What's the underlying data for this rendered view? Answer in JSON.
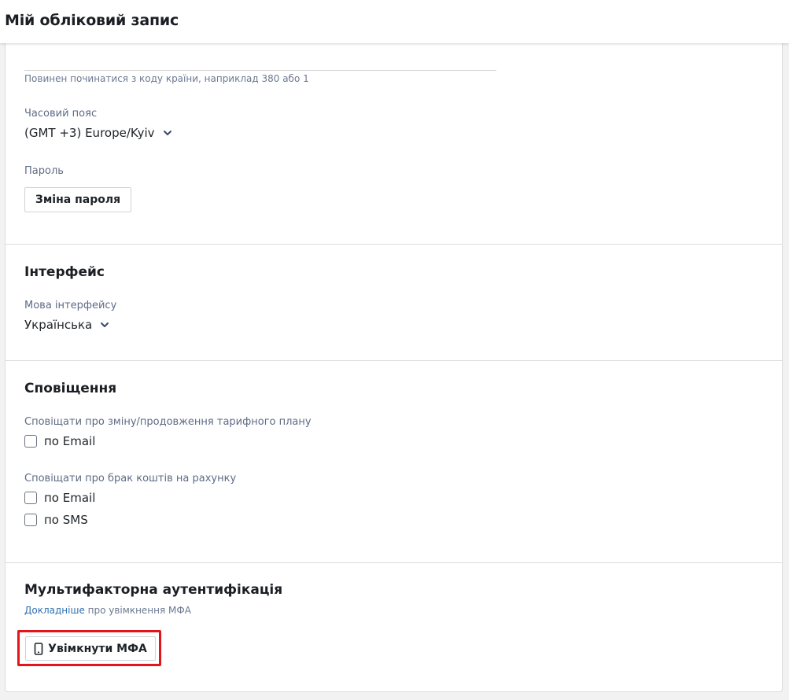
{
  "header": {
    "title": "Мій обліковий запис"
  },
  "account": {
    "phone_value": "",
    "phone_hint": "Повинен починатися з коду країни, наприклад 380 або 1",
    "timezone_label": "Часовий пояс",
    "timezone_value": "(GMT +3) Europe/Kyiv",
    "password_label": "Пароль",
    "change_password_button": "Зміна пароля"
  },
  "interface": {
    "title": "Інтерфейс",
    "language_label": "Мова інтерфейсу",
    "language_value": "Українська"
  },
  "notifications": {
    "title": "Сповіщення",
    "plan_change_label": "Сповіщати про зміну/продовження тарифного плану",
    "plan_change_email": "по Email",
    "low_balance_label": "Сповіщати про брак коштів на рахунку",
    "low_balance_email": "по Email",
    "low_balance_sms": "по SMS"
  },
  "mfa": {
    "title": "Мультифакторна аутентифікація",
    "more_link": "Докладніше",
    "more_text": " про увімкнення МФА",
    "enable_button": "Увімкнути МФА"
  },
  "colors": {
    "accent_link": "#2f6fb0",
    "highlight_border": "#e4141b",
    "label_text": "#5f6b85"
  },
  "icons": {
    "dropdown": "chevron-down-icon",
    "mfa_button": "phone-icon"
  }
}
